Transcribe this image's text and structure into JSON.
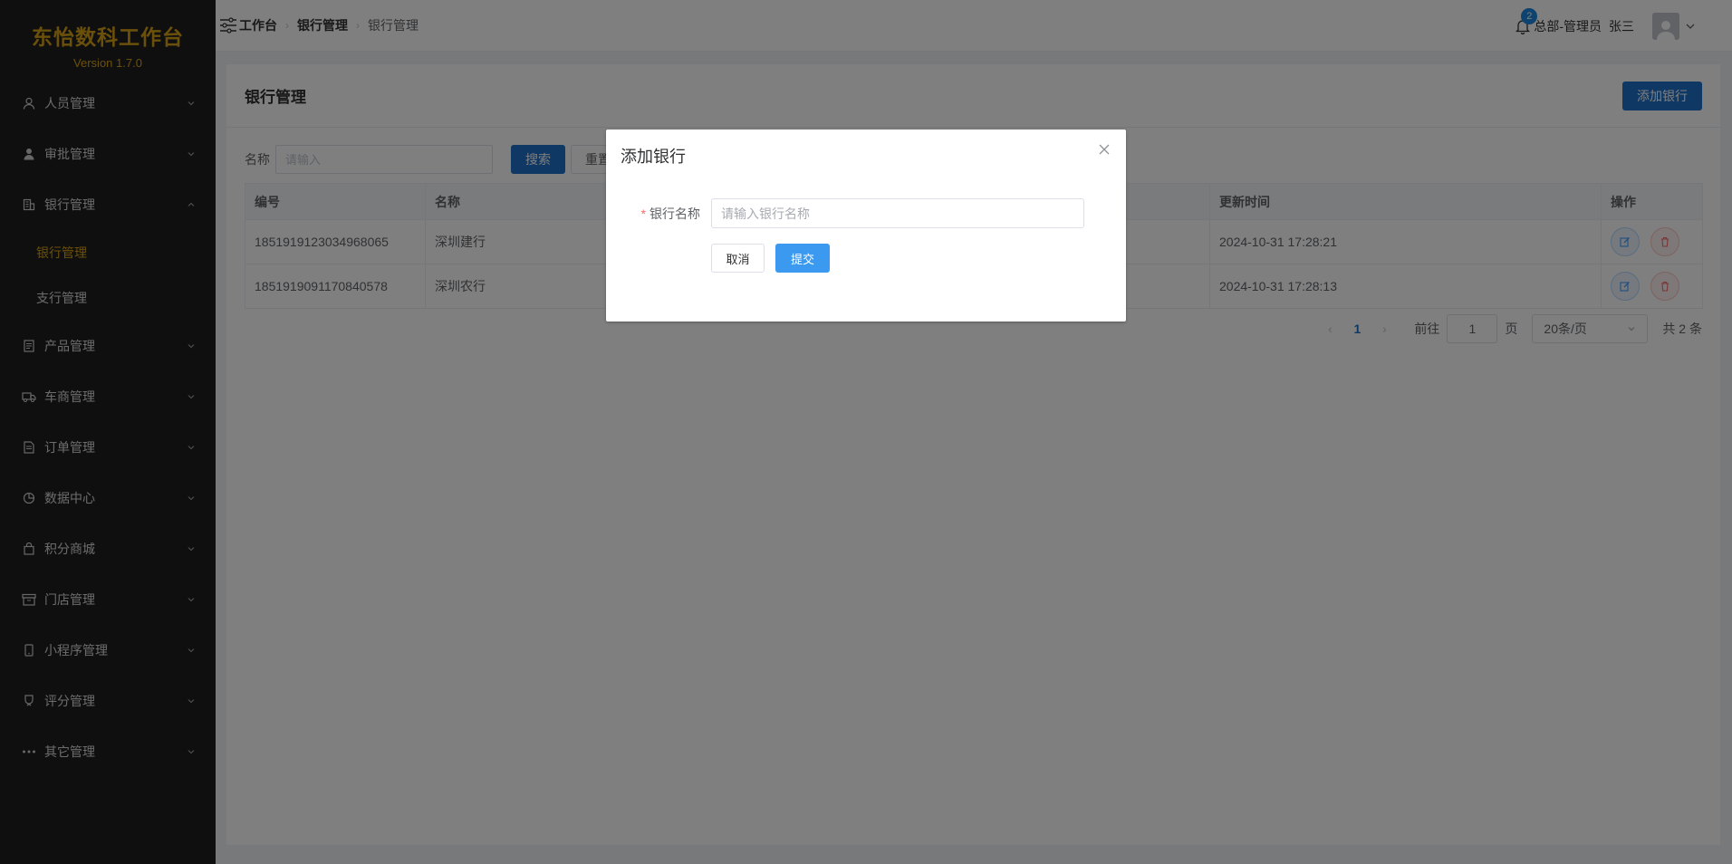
{
  "brand": {
    "title": "东怡数科工作台",
    "version": "Version 1.7.0"
  },
  "sidebar": {
    "items": [
      {
        "label": "人员管理",
        "icon": "user-icon",
        "expanded": false
      },
      {
        "label": "审批管理",
        "icon": "person-filled-icon",
        "expanded": false
      },
      {
        "label": "银行管理",
        "icon": "building-icon",
        "expanded": true,
        "children": [
          {
            "label": "银行管理",
            "active": true
          },
          {
            "label": "支行管理",
            "active": false
          }
        ]
      },
      {
        "label": "产品管理",
        "icon": "document-icon",
        "expanded": false
      },
      {
        "label": "车商管理",
        "icon": "truck-icon",
        "expanded": false
      },
      {
        "label": "订单管理",
        "icon": "order-icon",
        "expanded": false
      },
      {
        "label": "数据中心",
        "icon": "pie-chart-icon",
        "expanded": false
      },
      {
        "label": "积分商城",
        "icon": "shopping-bag-icon",
        "expanded": false
      },
      {
        "label": "门店管理",
        "icon": "box-icon",
        "expanded": false
      },
      {
        "label": "小程序管理",
        "icon": "phone-icon",
        "expanded": false
      },
      {
        "label": "评分管理",
        "icon": "medal-icon",
        "expanded": false
      },
      {
        "label": "其它管理",
        "icon": "more-dots-icon",
        "expanded": false
      }
    ]
  },
  "header": {
    "breadcrumb": [
      "工作台",
      "银行管理",
      "银行管理"
    ],
    "notification_count": "2",
    "role": "总部-管理员",
    "user_name": "张三"
  },
  "main": {
    "title": "银行管理",
    "add_button": "添加银行",
    "search": {
      "label": "名称",
      "placeholder": "请输入",
      "search_button": "搜索",
      "reset_button": "重置"
    },
    "table": {
      "columns": [
        "编号",
        "名称",
        "更新时间",
        "操作"
      ],
      "rows": [
        {
          "id": "1851919123034968065",
          "name": "深圳建行",
          "updated": "2024-10-31 17:28:21"
        },
        {
          "id": "1851919091170840578",
          "name": "深圳农行",
          "updated": "2024-10-31 17:28:13"
        }
      ]
    },
    "pagination": {
      "current_page": "1",
      "goto_label": "前往",
      "goto_value": "1",
      "page_suffix": "页",
      "page_size": "20条/页",
      "total": "共 2 条"
    }
  },
  "dialog": {
    "title": "添加银行",
    "field_label": "银行名称",
    "field_placeholder": "请输入银行名称",
    "cancel": "取消",
    "submit": "提交"
  },
  "colors": {
    "brand_gold": "#d4a017",
    "primary": "#1e70c8",
    "submit": "#3b99f0",
    "sidebar_bg": "#1f1f1f"
  }
}
